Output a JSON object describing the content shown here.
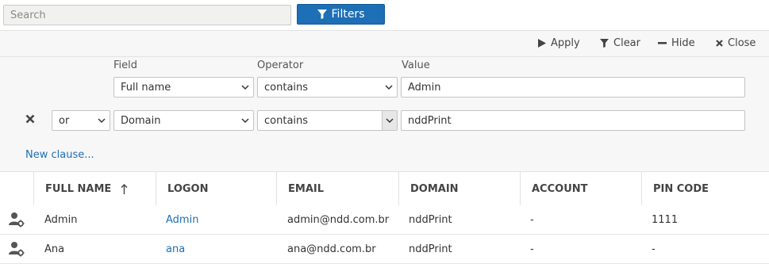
{
  "search": {
    "placeholder": "Search",
    "value": ""
  },
  "filters_button": {
    "label": "Filters",
    "icon": "funnel-icon",
    "color": "#1d6fb6"
  },
  "toolbar": {
    "apply": {
      "label": "Apply",
      "icon": "play-icon"
    },
    "clear": {
      "label": "Clear",
      "icon": "funnel-icon"
    },
    "hide": {
      "label": "Hide",
      "icon": "minus-icon"
    },
    "close": {
      "label": "Close",
      "icon": "close-icon"
    }
  },
  "filter": {
    "headers": {
      "field": "Field",
      "operator": "Operator",
      "value": "Value"
    },
    "clauses": [
      {
        "connector": "",
        "field": "Full name",
        "operator": "contains",
        "value": "Admin"
      },
      {
        "connector": "or",
        "field": "Domain",
        "operator": "contains",
        "value": "nddPrint"
      }
    ],
    "new_clause": "New clause..."
  },
  "table": {
    "columns": [
      "FULL NAME",
      "LOGON",
      "EMAIL",
      "DOMAIN",
      "ACCOUNT",
      "PIN CODE"
    ],
    "sorted_column": "FULL NAME",
    "sort_direction": "ascending",
    "rows": [
      {
        "full_name": "Admin",
        "logon": "Admin",
        "email": "admin@ndd.com.br",
        "domain": "nddPrint",
        "account": "-",
        "pin_code": "1111"
      },
      {
        "full_name": "Ana",
        "logon": "ana",
        "email": "ana@ndd.com.br",
        "domain": "nddPrint",
        "account": "-",
        "pin_code": "-"
      }
    ]
  }
}
